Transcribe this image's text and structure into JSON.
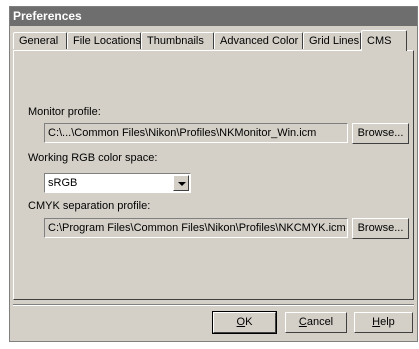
{
  "window": {
    "title": "Preferences"
  },
  "tabs": [
    {
      "label": "General"
    },
    {
      "label": "File Locations"
    },
    {
      "label": "Thumbnails"
    },
    {
      "label": "Advanced Color"
    },
    {
      "label": "Grid Lines"
    },
    {
      "label": "CMS"
    }
  ],
  "active_tab": "CMS",
  "cms": {
    "monitor_label": "Monitor profile:",
    "monitor_value": "C:\\...\\Common Files\\Nikon\\Profiles\\NKMonitor_Win.icm",
    "working_label": "Working RGB color space:",
    "working_value": "sRGB",
    "cmyk_label": "CMYK separation profile:",
    "cmyk_value": "C:\\Program Files\\Common Files\\Nikon\\Profiles\\NKCMYK.icm",
    "browse_label": "Browse..."
  },
  "footer": {
    "ok_accel": "O",
    "ok_rest": "K",
    "cancel_accel": "C",
    "cancel_rest": "ancel",
    "help_accel": "H",
    "help_rest": "elp"
  },
  "icons": {
    "dropdown": "chevron-down-icon"
  }
}
